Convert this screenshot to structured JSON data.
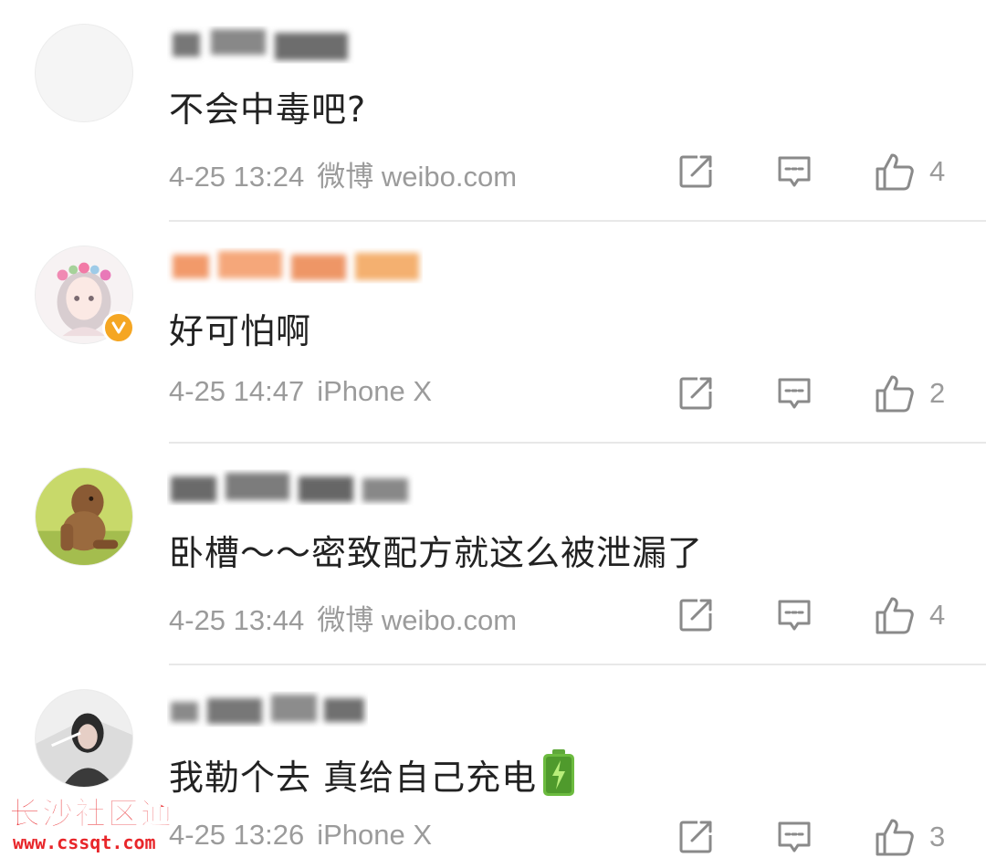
{
  "comments": [
    {
      "text": "不会中毒吧?",
      "date": "4-25 13:24",
      "source": "微博 weibo.com",
      "likes": "4",
      "username_blurred": true,
      "avatar": "blank-avatar",
      "verified": false
    },
    {
      "text": "好可怕啊",
      "date": "4-25 14:47",
      "source": "iPhone X",
      "likes": "2",
      "username_blurred": true,
      "avatar": "anime-girl-flower-crown-avatar",
      "verified": true
    },
    {
      "text": "卧槽～～密致配方就这么被泄漏了",
      "date": "4-25 13:44",
      "source": "微博 weibo.com",
      "likes": "4",
      "username_blurred": true,
      "avatar": "caveman-avatar",
      "verified": false
    },
    {
      "text": "我勒个去 真给自己充电",
      "date": "4-25 13:26",
      "source": "iPhone X",
      "likes": "3",
      "username_blurred": true,
      "avatar": "girl-photo-avatar",
      "verified": false,
      "emoji": "battery-charging-icon"
    }
  ],
  "watermark": {
    "title": "长沙社区通",
    "url": "www.cssqt.com"
  },
  "colors": {
    "text": "#222222",
    "meta": "#9b9b9b",
    "divider": "#e8e8e8",
    "verified_badge": "#f5a623",
    "watermark": "#e8262a"
  }
}
